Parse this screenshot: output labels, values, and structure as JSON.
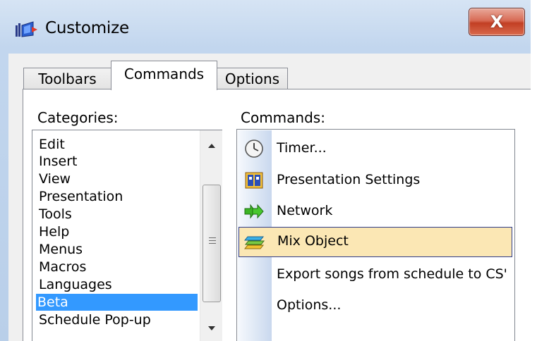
{
  "window": {
    "title": "Customize",
    "close_symbol": "X"
  },
  "tabs": [
    {
      "label": "Toolbars",
      "active": false
    },
    {
      "label": "Commands",
      "active": true
    },
    {
      "label": "Options",
      "active": false
    }
  ],
  "categories": {
    "label": "Categories:",
    "items": [
      "Edit",
      "Insert",
      "View",
      "Presentation",
      "Tools",
      "Help",
      "Menus",
      "Macros",
      "Languages",
      "Beta",
      "Schedule Pop-up"
    ],
    "selected": "Beta"
  },
  "commands": {
    "label": "Commands:",
    "items": [
      {
        "label": "Timer...",
        "icon": "clock-icon"
      },
      {
        "label": "Presentation Settings",
        "icon": "presentation-settings-icon"
      },
      {
        "label": "Network",
        "icon": "network-arrows-icon"
      },
      {
        "label": "Mix Object",
        "icon": "mix-layers-icon",
        "highlighted": true
      },
      {
        "label": "Export songs from schedule to CS'",
        "icon": ""
      },
      {
        "label": "Options...",
        "icon": ""
      }
    ]
  },
  "colors": {
    "selection": "#3399ff",
    "hover_fill": "#fbe7b4",
    "hover_border": "#2f3d8a",
    "close_button": "#c94a33"
  }
}
